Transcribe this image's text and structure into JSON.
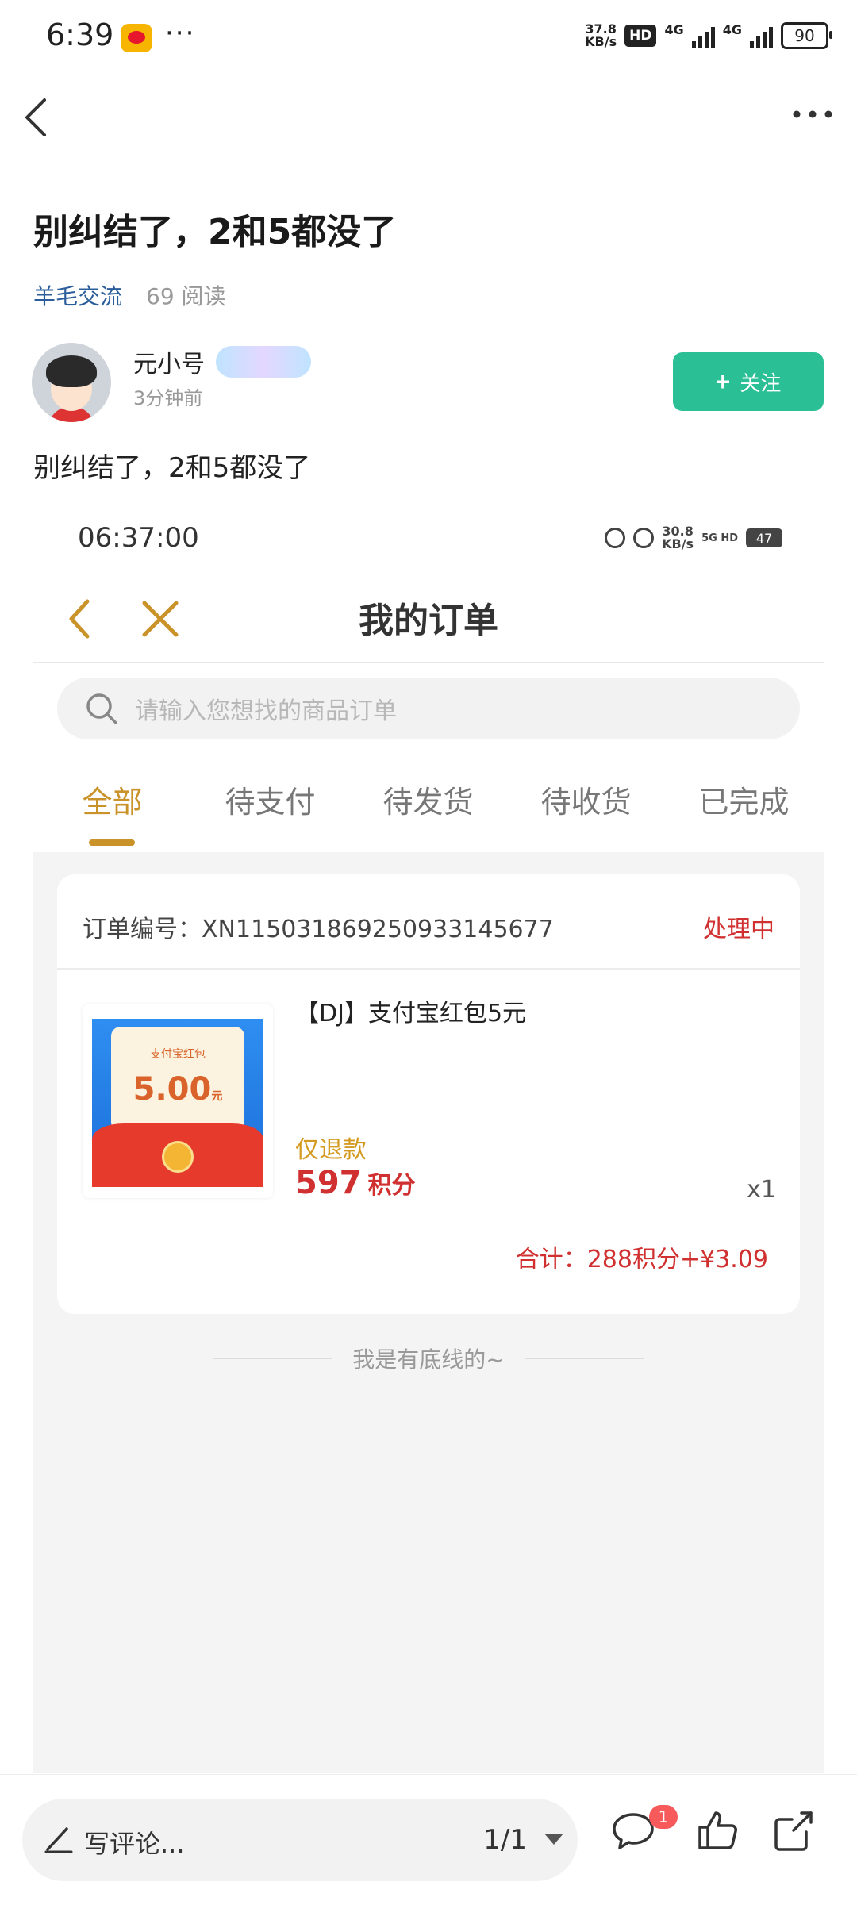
{
  "status_bar": {
    "time": "6:39",
    "overflow_dots": "···",
    "net_speed_value": "37.8",
    "net_speed_unit": "KB/s",
    "hd": "HD",
    "net1": "4G",
    "net2": "4G",
    "battery": "90"
  },
  "header": {
    "back_icon": "back-arrow-icon",
    "more_icon": "more-dots-icon"
  },
  "post": {
    "title": "别纠结了，2和5都没了",
    "topic": "羊毛交流",
    "reads": "69 阅读",
    "author": "元小号",
    "time": "3分钟前",
    "follow_label": "关注",
    "body": "别纠结了，2和5都没了"
  },
  "screenshot": {
    "time": "06:37:00",
    "net_speed_value": "30.8",
    "net_speed_unit": "KB/s",
    "net": "5G HD",
    "battery": "47",
    "title": "我的订单",
    "search_placeholder": "请输入您想找的商品订单",
    "tabs": [
      "全部",
      "待支付",
      "待发货",
      "待收货",
      "已完成"
    ],
    "active_tab": 0,
    "order": {
      "number_label": "订单编号：XN115031869250933145677",
      "status": "处理中",
      "product_name": "【DJ】支付宝红包5元",
      "thumb_title": "支付宝红包",
      "thumb_amount": "5.00",
      "thumb_unit": "元",
      "refund_label": "仅退款",
      "points_value": "597",
      "points_unit": "积分",
      "quantity": "x1",
      "total": "合计：288积分+¥3.09"
    },
    "end_text": "我是有底线的~"
  },
  "bottom_bar": {
    "comment_placeholder": "写评论...",
    "pager": "1/1",
    "comment_badge": "1"
  },
  "colors": {
    "follow_button": "#2bbf95",
    "topic_link": "#2b5d9a",
    "accent_gold": "#c9932a",
    "order_red": "#d0302f"
  }
}
